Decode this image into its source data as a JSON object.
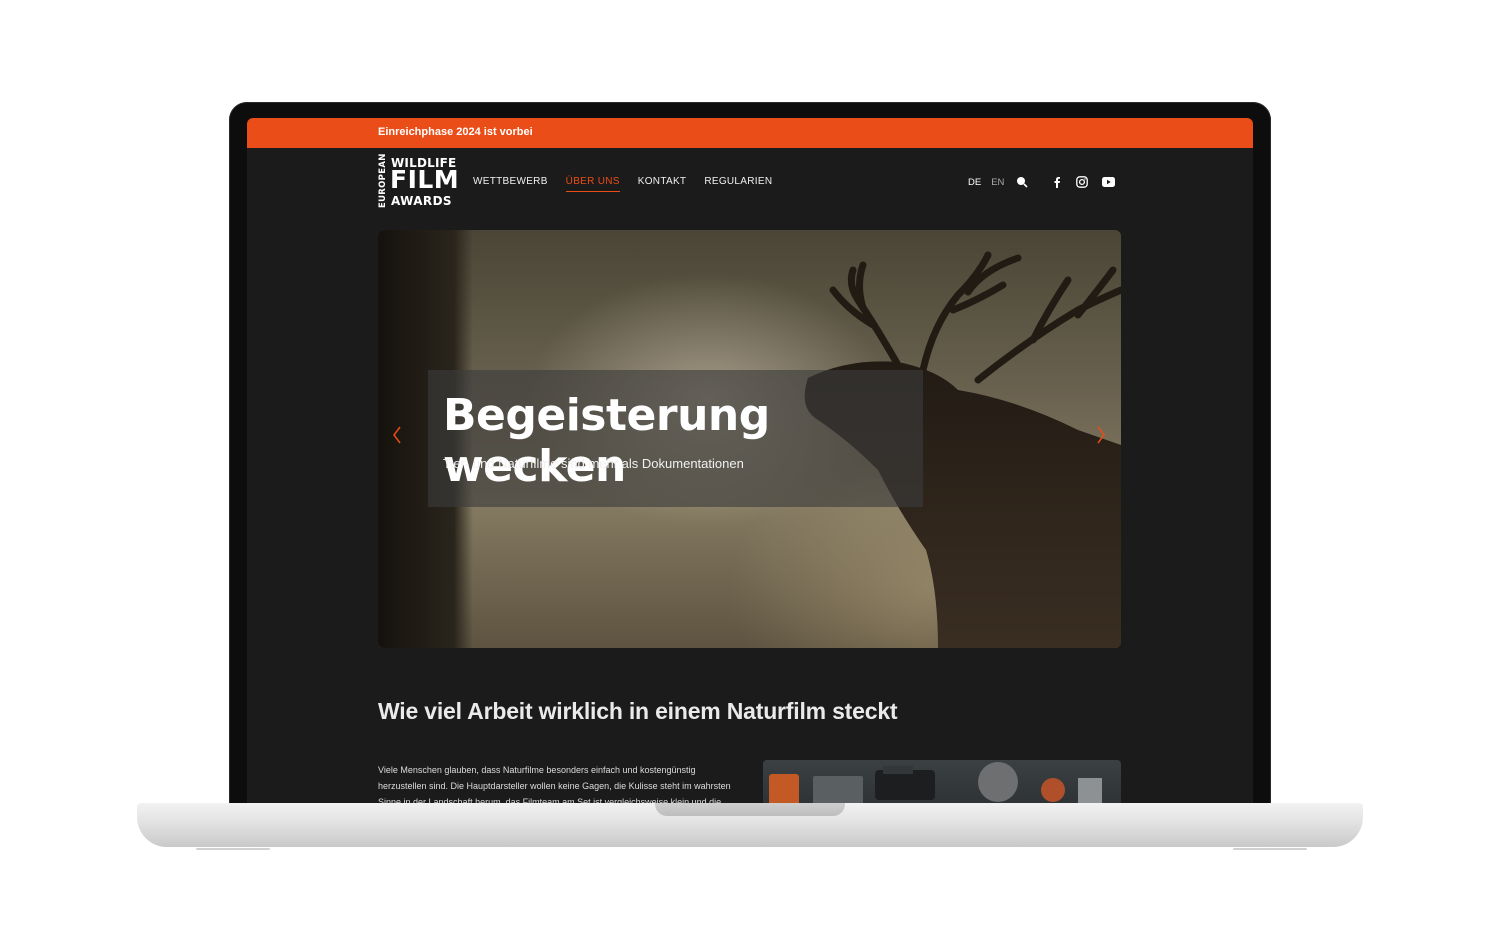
{
  "announcement": {
    "text": "Einreichphase 2024 ist vorbei"
  },
  "logo": {
    "vertical": "EUROPEAN",
    "line1": "WILDLIFE",
    "line2": "FILM",
    "line3": "AWARDS"
  },
  "nav": [
    {
      "label": "WETTBEWERB",
      "active": false
    },
    {
      "label": "ÜBER UNS",
      "active": true
    },
    {
      "label": "KONTAKT",
      "active": false
    },
    {
      "label": "REGULARIEN",
      "active": false
    }
  ],
  "lang": {
    "de": "DE",
    "en": "EN"
  },
  "icons": [
    "search-icon",
    "facebook-icon",
    "instagram-icon",
    "youtube-icon",
    "chevron-left-icon",
    "chevron-right-icon"
  ],
  "hero": {
    "title": "Begeisterung wecken",
    "subtitle": "Tier- und Naturfilme sind mehr als Dokumentationen"
  },
  "section": {
    "title": "Wie viel Arbeit wirklich in einem Naturfilm steckt",
    "body": "Viele Menschen glauben, dass Naturfilme besonders einfach und kostengünstig herzustellen sind. Die Hauptdarsteller wollen keine Gagen, die Kulisse steht im wahrsten Sinne in der Landschaft herum, das Filmteam am Set ist vergleichsweise klein und die Story schreibt sich"
  },
  "colors": {
    "accent": "#ea4d17",
    "page_bg": "#1b1b1b"
  }
}
